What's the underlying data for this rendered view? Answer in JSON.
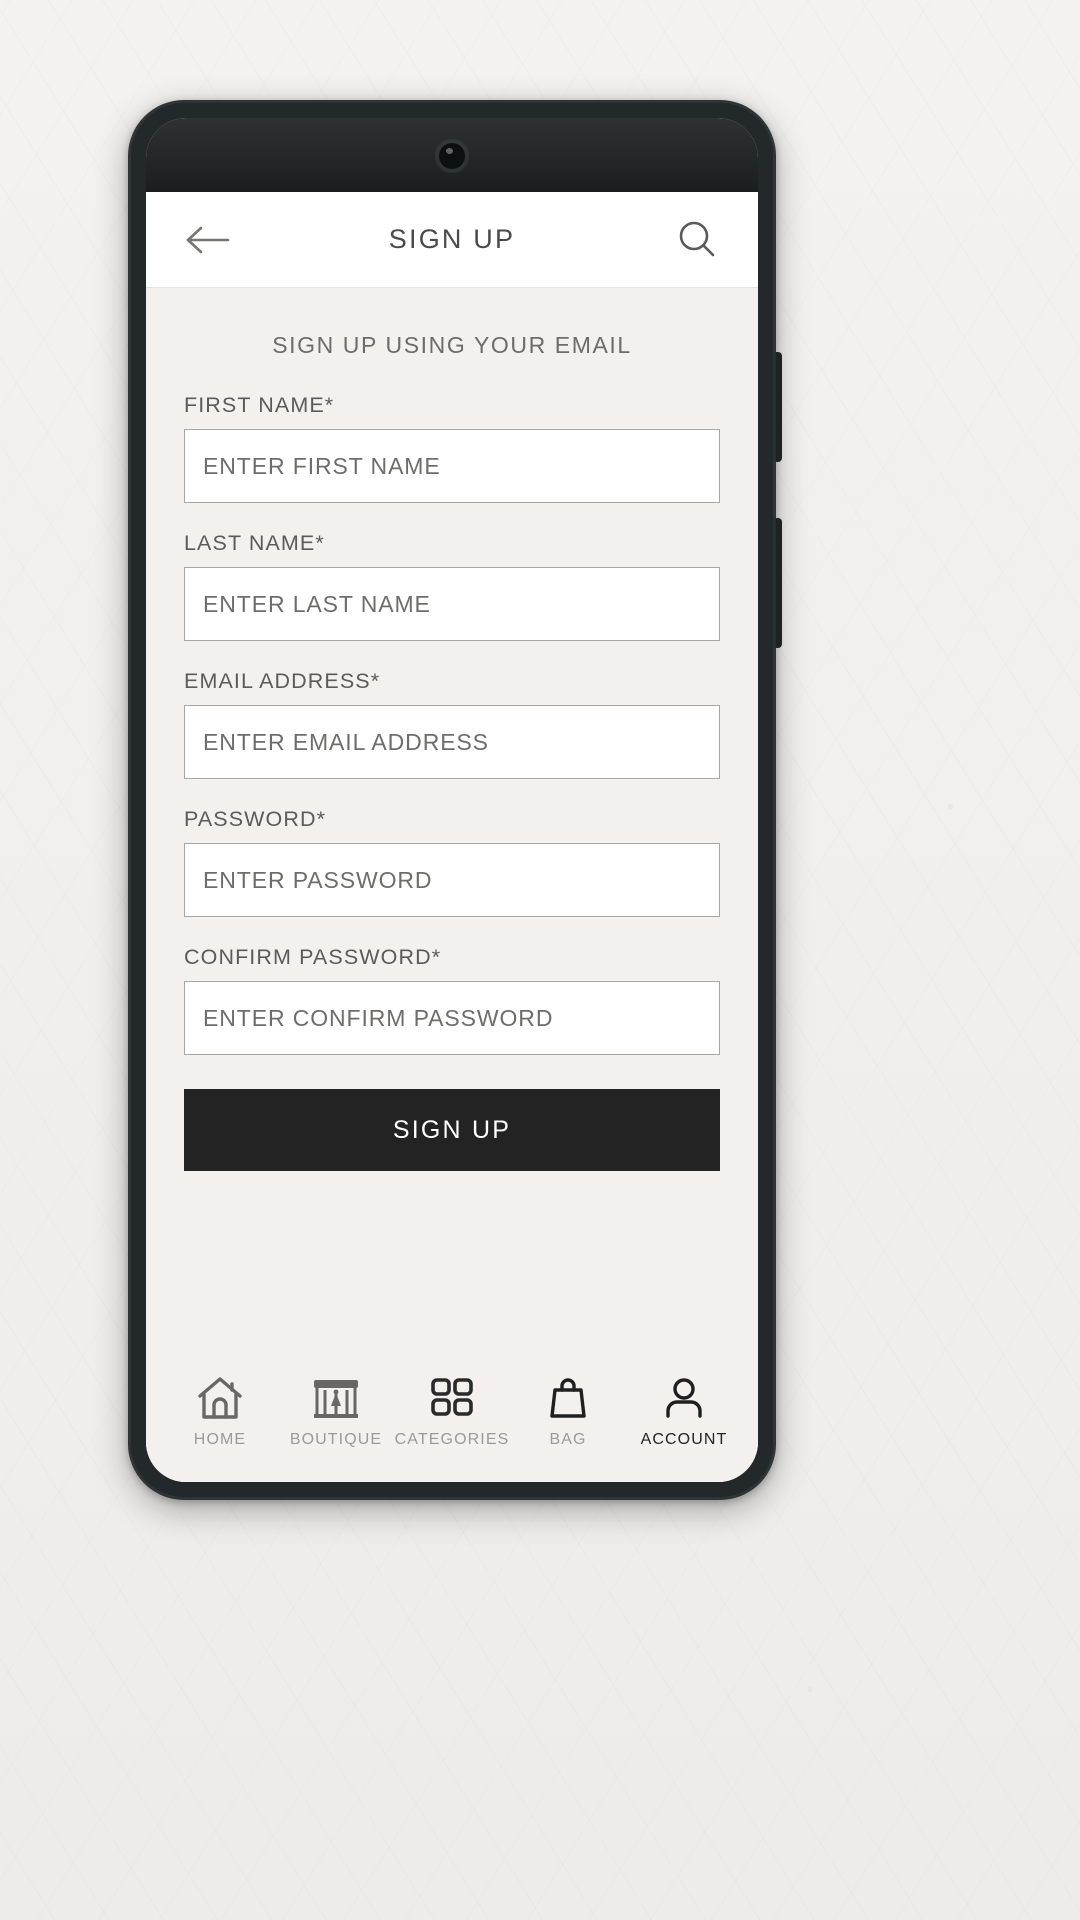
{
  "header": {
    "title": "SIGN UP",
    "back_icon": "arrow-left-icon",
    "search_icon": "search-icon"
  },
  "main": {
    "section_title": "SIGN UP USING YOUR EMAIL",
    "fields": [
      {
        "label": "FIRST NAME*",
        "placeholder": "ENTER FIRST NAME",
        "value": "",
        "type": "text"
      },
      {
        "label": "LAST NAME*",
        "placeholder": "ENTER LAST NAME",
        "value": "",
        "type": "text"
      },
      {
        "label": "EMAIL ADDRESS*",
        "placeholder": "ENTER EMAIL ADDRESS",
        "value": "",
        "type": "text"
      },
      {
        "label": "PASSWORD*",
        "placeholder": "ENTER PASSWORD",
        "value": "",
        "type": "text"
      },
      {
        "label": "CONFIRM PASSWORD*",
        "placeholder": "ENTER CONFIRM PASSWORD",
        "value": "",
        "type": "text"
      }
    ],
    "submit_label": "SIGN UP"
  },
  "bottom_nav": {
    "items": [
      {
        "label": "HOME",
        "icon": "home-icon",
        "active": false
      },
      {
        "label": "BOUTIQUE",
        "icon": "store-icon",
        "active": false
      },
      {
        "label": "CATEGORIES",
        "icon": "grid-icon",
        "active": false
      },
      {
        "label": "BAG",
        "icon": "shopping-bag-icon",
        "active": false
      },
      {
        "label": "ACCOUNT",
        "icon": "person-icon",
        "active": true
      }
    ]
  },
  "colors": {
    "page_background": "#f2f0ee",
    "phone_frame": "#23282a",
    "app_background": "#f3f0ee",
    "header_background": "#ffffff",
    "input_background": "#ffffff",
    "input_border": "#a8a6a4",
    "primary_button": "#232323",
    "primary_button_text": "#ffffff",
    "label_text": "#5d5b59",
    "muted_text": "#9c9a98",
    "active_nav_text": "#242424"
  }
}
